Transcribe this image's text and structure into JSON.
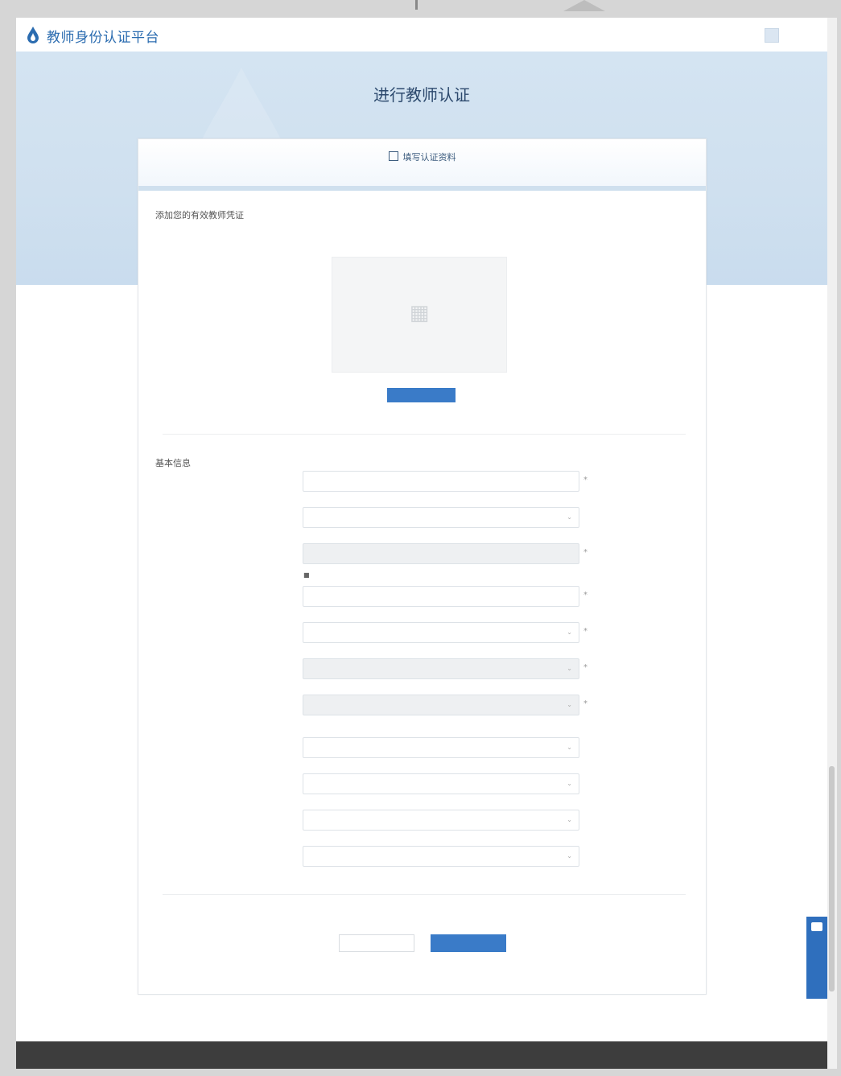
{
  "site": {
    "title": "教师身份认证平台"
  },
  "header": {
    "user_name": "",
    "logo_icon": "drop-logo-icon",
    "avatar_icon": "user-avatar-icon"
  },
  "hero": {
    "title": "进行教师认证",
    "subtitle": ""
  },
  "card": {
    "title": "填写认证资料",
    "description": "",
    "upload_section_title": "添加您的有效教师凭证",
    "upload_button": "",
    "upload_hint": "",
    "basic_section_title": "基本信息"
  },
  "fields": [
    {
      "label": "",
      "placeholder": "",
      "select": false,
      "disabled": false,
      "required": true
    },
    {
      "label": "",
      "placeholder": "",
      "select": true,
      "disabled": false,
      "required": false
    },
    {
      "label": "",
      "placeholder": "",
      "select": false,
      "disabled": true,
      "required": true
    },
    {
      "label": "",
      "placeholder": "",
      "select": false,
      "disabled": false,
      "required": true
    },
    {
      "label": "",
      "placeholder": "",
      "select": true,
      "disabled": false,
      "required": true
    },
    {
      "label": "",
      "placeholder": "",
      "select": true,
      "disabled": true,
      "required": true
    },
    {
      "label": "",
      "placeholder": "",
      "select": true,
      "disabled": true,
      "required": true
    },
    {
      "label": "",
      "placeholder": "",
      "select": true,
      "disabled": false,
      "required": false
    },
    {
      "label": "",
      "placeholder": "",
      "select": true,
      "disabled": false,
      "required": false
    },
    {
      "label": "",
      "placeholder": "",
      "select": true,
      "disabled": false,
      "required": false
    },
    {
      "label": "",
      "placeholder": "",
      "select": true,
      "disabled": false,
      "required": false
    }
  ],
  "notes": {
    "phone_note": "",
    "school_note": ""
  },
  "actions": {
    "cancel": "",
    "submit": ""
  },
  "service": {
    "label": "",
    "icon": "chat-icon"
  },
  "footer": {
    "left": "",
    "right": ""
  },
  "colors": {
    "brand": "#2b6cb0",
    "primary_button": "#3a7bc8",
    "hero_bg": "#d4e4f2",
    "footer_bg": "#3d3d3d"
  }
}
